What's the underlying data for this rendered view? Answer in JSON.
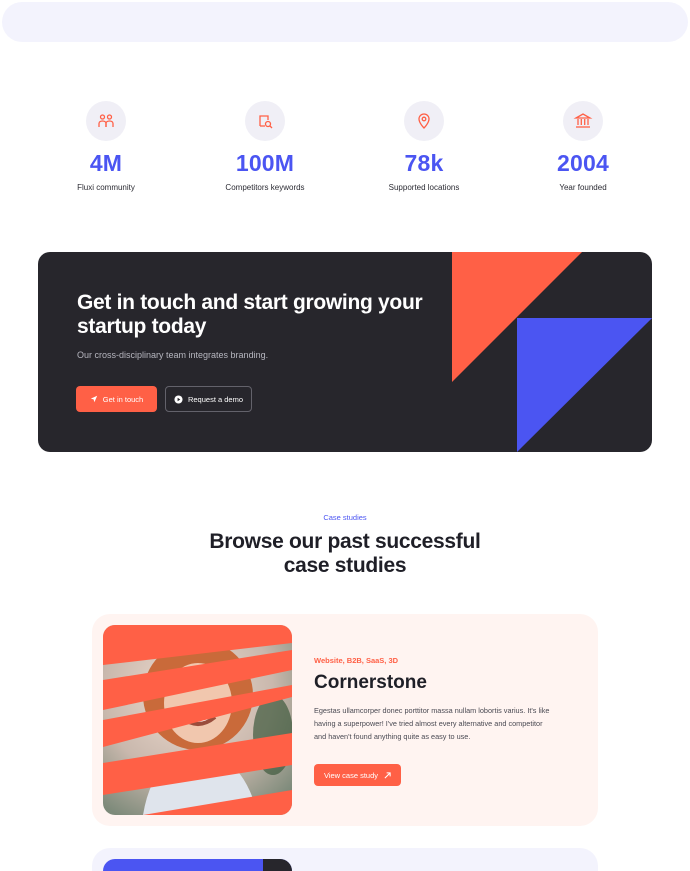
{
  "stats": [
    {
      "icon": "team-icon",
      "value": "4M",
      "label": "Fluxi community"
    },
    {
      "icon": "search-document-icon",
      "value": "100M",
      "label": "Competitors keywords"
    },
    {
      "icon": "location-pin-icon",
      "value": "78k",
      "label": "Supported locations"
    },
    {
      "icon": "bank-building-icon",
      "value": "2004",
      "label": "Year founded"
    }
  ],
  "cta": {
    "title": "Get in touch and start growing your startup today",
    "subtitle": "Our cross-disciplinary team integrates branding.",
    "primary_button": "Get in touch",
    "secondary_button": "Request a demo"
  },
  "case_studies": {
    "eyebrow": "Case studies",
    "title": "Browse our past successful case studies",
    "cards": [
      {
        "tag": "Website, B2B, SaaS, 3D",
        "title": "Cornerstone",
        "description": "Egestas ullamcorper donec porttitor massa nullam lobortis varius. It's like having a superpower! I've tried almost every alternative and competitor and haven't found anything quite as easy to use.",
        "button": "View case study"
      }
    ]
  },
  "colors": {
    "accent_blue": "#4b55f2",
    "accent_coral": "#ff6046",
    "dark_panel": "#27262c"
  }
}
